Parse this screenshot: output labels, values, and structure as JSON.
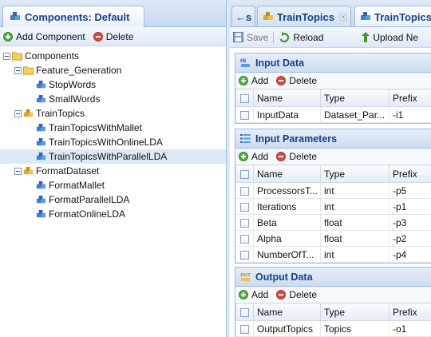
{
  "left_panel": {
    "tab_title": "Components: Default",
    "toolbar": {
      "add_label": "Add Component",
      "delete_label": "Delete"
    },
    "tree": [
      {
        "label": "Components",
        "level": 0,
        "icon": "folder-icon",
        "expanded": true
      },
      {
        "label": "Feature_Generation",
        "level": 1,
        "icon": "folder-icon",
        "expanded": true
      },
      {
        "label": "StopWords",
        "level": 2,
        "icon": "component-icon"
      },
      {
        "label": "SmallWords",
        "level": 2,
        "icon": "component-icon"
      },
      {
        "label": "TrainTopics",
        "level": 1,
        "icon": "component-group-icon",
        "expanded": true
      },
      {
        "label": "TrainTopicsWithMallet",
        "level": 2,
        "icon": "component-icon"
      },
      {
        "label": "TrainTopicsWithOnlineLDA",
        "level": 2,
        "icon": "component-icon"
      },
      {
        "label": "TrainTopicsWithParallelLDA",
        "level": 2,
        "icon": "component-icon",
        "selected": true
      },
      {
        "label": "FormatDataset",
        "level": 1,
        "icon": "component-group-icon",
        "expanded": true
      },
      {
        "label": "FormatMallet",
        "level": 2,
        "icon": "component-icon"
      },
      {
        "label": "FormatParallelLDA",
        "level": 2,
        "icon": "component-icon"
      },
      {
        "label": "FormatOnlineLDA",
        "level": 2,
        "icon": "component-icon"
      }
    ]
  },
  "right_panel": {
    "tabs": [
      {
        "label": "←s"
      },
      {
        "label": "TrainTopics",
        "close": "×"
      },
      {
        "label": "TrainTopics"
      }
    ],
    "toolbar": {
      "save_label": "Save",
      "reload_label": "Reload",
      "upload_label": "Upload Ne"
    },
    "input_data": {
      "title": "Input Data",
      "add_label": "Add",
      "delete_label": "Delete",
      "columns": [
        "Name",
        "Type",
        "Prefix"
      ],
      "rows": [
        {
          "name": "InputData",
          "type": "Dataset_Par...",
          "prefix": "-i1"
        }
      ]
    },
    "input_parameters": {
      "title": "Input Parameters",
      "add_label": "Add",
      "delete_label": "Delete",
      "columns": [
        "Name",
        "Type",
        "Prefix"
      ],
      "rows": [
        {
          "name": "ProcessorsT...",
          "type": "int",
          "prefix": "-p5"
        },
        {
          "name": "Iterations",
          "type": "int",
          "prefix": "-p1"
        },
        {
          "name": "Beta",
          "type": "float",
          "prefix": "-p3"
        },
        {
          "name": "Alpha",
          "type": "float",
          "prefix": "-p2"
        },
        {
          "name": "NumberOfT...",
          "type": "int",
          "prefix": "-p4"
        }
      ]
    },
    "output_data": {
      "title": "Output Data",
      "add_label": "Add",
      "delete_label": "Delete",
      "columns": [
        "Name",
        "Type",
        "Prefix"
      ],
      "rows": [
        {
          "name": "OutputTopics",
          "type": "Topics",
          "prefix": "-o1"
        }
      ]
    }
  },
  "colors": {
    "header_text": "#15428b",
    "panel_border": "#99bbe8",
    "selection": "#dfe8f6",
    "add_green": "#4fae3c",
    "delete_red": "#e0473c"
  }
}
